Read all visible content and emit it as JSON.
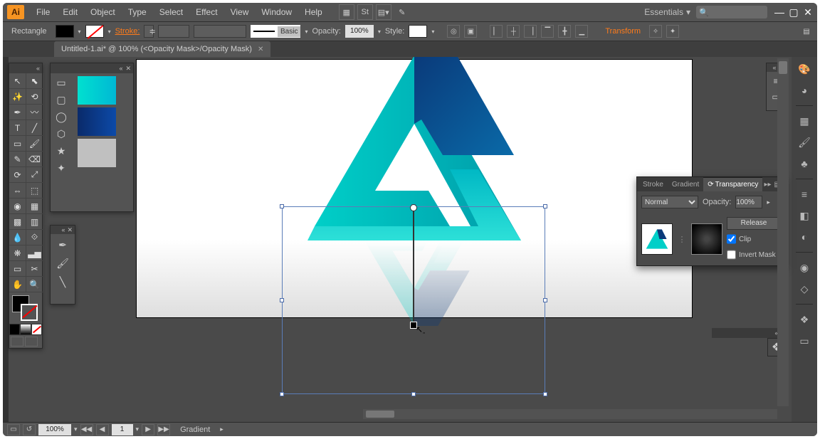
{
  "app": {
    "logo_text": "Ai"
  },
  "menu": {
    "items": [
      "File",
      "Edit",
      "Object",
      "Type",
      "Select",
      "Effect",
      "View",
      "Window",
      "Help"
    ]
  },
  "workspace": {
    "label": "Essentials"
  },
  "search": {
    "placeholder": ""
  },
  "control": {
    "shape": "Rectangle",
    "stroke_label": "Stroke:",
    "brush_label": "Basic",
    "opacity_label": "Opacity:",
    "opacity_value": "100%",
    "style_label": "Style:",
    "transform_label": "Transform"
  },
  "tab": {
    "title": "Untitled-1.ai* @ 100% (<Opacity Mask>/Opacity Mask)"
  },
  "transparency": {
    "tabs": [
      "Stroke",
      "Gradient",
      "Transparency"
    ],
    "active_tab": 2,
    "blend_mode": "Normal",
    "opacity_label": "Opacity:",
    "opacity_value": "100%",
    "release_btn": "Release",
    "clip_label": "Clip",
    "clip_checked": true,
    "invert_label": "Invert Mask",
    "invert_checked": false
  },
  "status": {
    "zoom": "100%",
    "page": "1",
    "tool": "Gradient"
  },
  "swatches": {
    "colors": [
      "linear-gradient(90deg,#00e0d0,#00b8d4)",
      "linear-gradient(90deg,#0a2a6a,#0c4aa8)",
      "#c0c0c0"
    ]
  }
}
